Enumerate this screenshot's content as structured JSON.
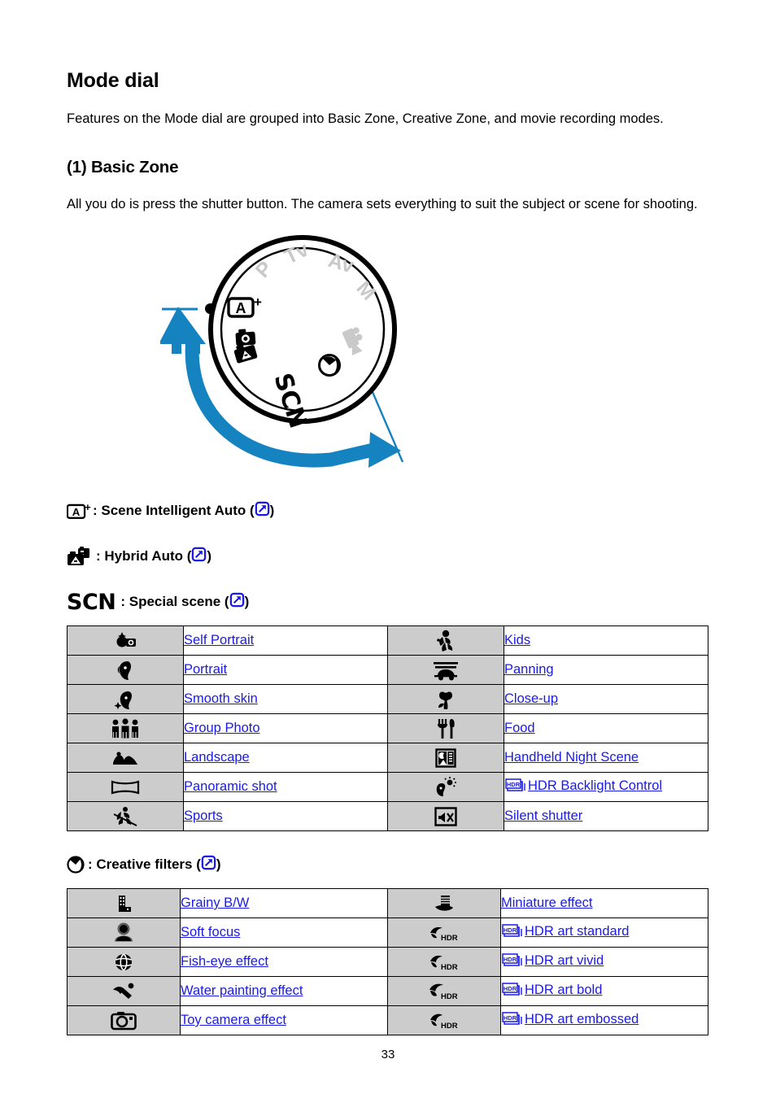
{
  "document": {
    "page_number": "33",
    "title": "Mode dial",
    "intro": "Features on the Mode dial are grouped into Basic Zone, Creative Zone, and movie recording modes.",
    "section_title": "(1) Basic Zone",
    "section_intro": "All you do is press the shutter button. The camera sets everything to suit the subject or scene for shooting."
  },
  "colors": {
    "link_blue": "#1a1ae6",
    "arrow_blue": "#1583bf",
    "icon_cell_gray": "#cccccc",
    "dial_inactive_gray": "#c9c9c9",
    "text_black": "#000000"
  },
  "dial": {
    "name": "mode-dial-illustration",
    "index_mark_label": "index mark",
    "active_positions": [
      "A+",
      "Hybrid Auto",
      "SCN",
      "Creative filters"
    ],
    "inactive_positions": [
      "P",
      "Tv",
      "Av",
      "M",
      "Movie"
    ],
    "rotation_arrow": "counter-clockwise turn arrow"
  },
  "legend": [
    {
      "icon": "scene-intelligent-auto-icon",
      "label": ": Scene Intelligent Auto (",
      "label_end": ")",
      "link_icon": "external-link-icon"
    },
    {
      "icon": "hybrid-auto-icon",
      "label": ": Hybrid Auto (",
      "label_end": ")",
      "link_icon": "external-link-icon"
    },
    {
      "icon": "scn-wordmark",
      "icon_text": "SCN",
      "label": ": Special scene (",
      "label_end": ")",
      "link_icon": "external-link-icon"
    },
    {
      "icon": "creative-filters-icon",
      "label": ": Creative filters (",
      "label_end": ")",
      "link_icon": "external-link-icon"
    }
  ],
  "scene_table": {
    "name": "special-scene-table",
    "rows": [
      {
        "left": {
          "icon": "self-portrait-icon",
          "label": "Self Portrait"
        },
        "right": {
          "icon": "kids-icon",
          "label": "Kids"
        }
      },
      {
        "left": {
          "icon": "portrait-icon",
          "label": "Portrait"
        },
        "right": {
          "icon": "panning-icon",
          "label": "Panning"
        }
      },
      {
        "left": {
          "icon": "smooth-skin-icon",
          "label": "Smooth skin"
        },
        "right": {
          "icon": "close-up-icon",
          "label": "Close-up"
        }
      },
      {
        "left": {
          "icon": "group-photo-icon",
          "label": "Group Photo"
        },
        "right": {
          "icon": "food-icon",
          "label": "Food"
        }
      },
      {
        "left": {
          "icon": "landscape-icon",
          "label": "Landscape"
        },
        "right": {
          "icon": "handheld-night-scene-icon",
          "label": "Handheld Night Scene"
        }
      },
      {
        "left": {
          "icon": "panoramic-shot-icon",
          "label": "Panoramic shot"
        },
        "right": {
          "icon": "hdr-backlight-icon",
          "label": "HDR Backlight Control",
          "badge": "HDR"
        }
      },
      {
        "left": {
          "icon": "sports-icon",
          "label": "Sports"
        },
        "right": {
          "icon": "silent-shutter-icon",
          "label": "Silent shutter"
        }
      }
    ]
  },
  "filter_table": {
    "name": "creative-filters-table",
    "rows": [
      {
        "left": {
          "icon": "grainy-bw-icon",
          "label": "Grainy B/W"
        },
        "right": {
          "icon": "miniature-effect-icon",
          "label": "Miniature effect"
        }
      },
      {
        "left": {
          "icon": "soft-focus-icon",
          "label": "Soft focus"
        },
        "right": {
          "icon": "hdr-art-standard-icon",
          "label": "HDR art standard",
          "badge": "HDR"
        }
      },
      {
        "left": {
          "icon": "fish-eye-effect-icon",
          "label": "Fish-eye effect"
        },
        "right": {
          "icon": "hdr-art-vivid-icon",
          "label": "HDR art vivid",
          "badge": "HDR"
        }
      },
      {
        "left": {
          "icon": "water-painting-effect-icon",
          "label": "Water painting effect"
        },
        "right": {
          "icon": "hdr-art-bold-icon",
          "label": "HDR art bold",
          "badge": "HDR"
        }
      },
      {
        "left": {
          "icon": "toy-camera-effect-icon",
          "label": "Toy camera effect"
        },
        "right": {
          "icon": "hdr-art-embossed-icon",
          "label": "HDR art embossed",
          "badge": "HDR"
        }
      }
    ]
  }
}
